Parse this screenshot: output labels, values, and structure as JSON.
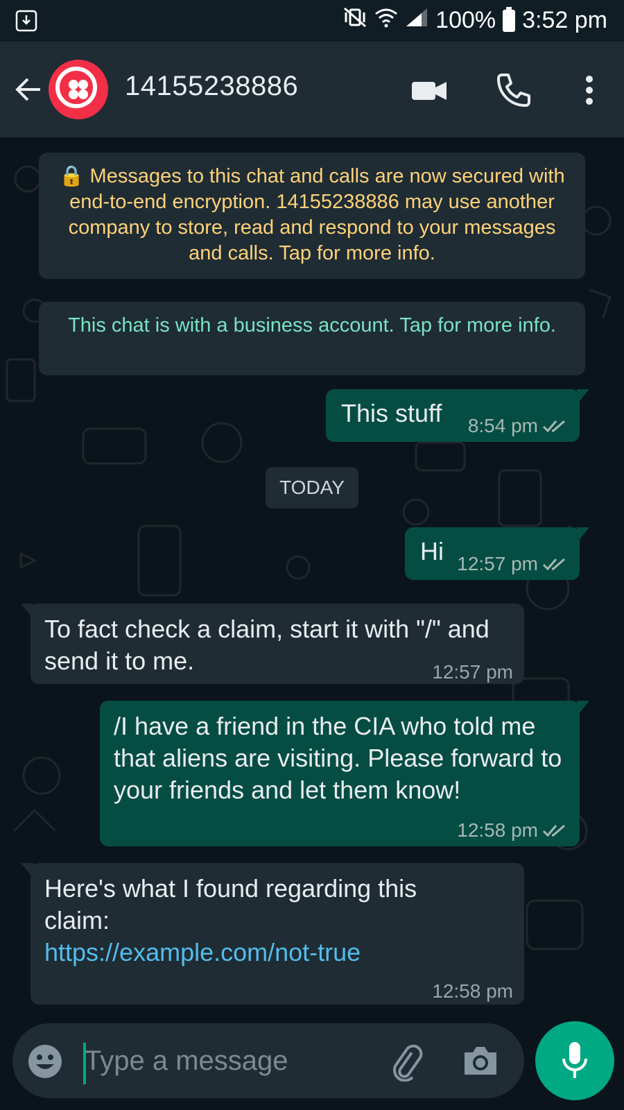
{
  "status_bar": {
    "battery": "100%",
    "time": "3:52 pm"
  },
  "header": {
    "contact_name": "14155238886",
    "avatar_color": "#f22f46"
  },
  "chat": {
    "encryption_notice": "🔒 Messages to this chat and calls are now secured with end-to-end encryption. 14155238886 may use another company to store, read and respond to your messages and calls. Tap for more info.",
    "business_notice": "This chat is with a business account. Tap for more info.",
    "date_divider": "TODAY",
    "messages": [
      {
        "direction": "out",
        "text": "This stuff",
        "time": "8:54 pm",
        "status": "read"
      },
      {
        "direction": "out",
        "text": "Hi",
        "time": "12:57 pm",
        "status": "read"
      },
      {
        "direction": "in",
        "text": "To fact check a claim, start it with \"/\" and send it to me.",
        "time": "12:57 pm"
      },
      {
        "direction": "out",
        "text": "/I have a friend in the CIA who told me that aliens are visiting. Please forward to your friends and let them know!",
        "time": "12:58 pm",
        "status": "read"
      },
      {
        "direction": "in",
        "text": "Here's what I found regarding this claim:",
        "link": "https://example.com/not-true",
        "time": "12:58 pm"
      }
    ]
  },
  "input": {
    "placeholder": "Type a message",
    "value": ""
  },
  "colors": {
    "accent": "#00a884",
    "outgoing_bubble": "#054d42",
    "incoming_bubble": "#1f2c34",
    "encryption_text": "#ffd279",
    "business_text": "#7ae3c3",
    "link": "#53bdeb"
  }
}
